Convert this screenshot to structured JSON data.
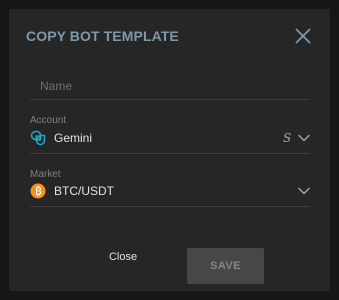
{
  "dialog": {
    "title": "COPY BOT TEMPLATE"
  },
  "form": {
    "name": {
      "placeholder": "Name",
      "value": ""
    },
    "account": {
      "label": "Account",
      "value": "Gemini",
      "value_icon": "gemini-icon",
      "extra_glyph": "S"
    },
    "market": {
      "label": "Market",
      "value": "BTC/USDT",
      "value_icon": "bitcoin-icon"
    }
  },
  "actions": {
    "close_label": "Close",
    "save_label": "SAVE"
  },
  "colors": {
    "title": "#7e98a9",
    "accent_gemini": "#1ea7c8",
    "bitcoin": "#f7931a",
    "save_button_bg": "#474747"
  }
}
